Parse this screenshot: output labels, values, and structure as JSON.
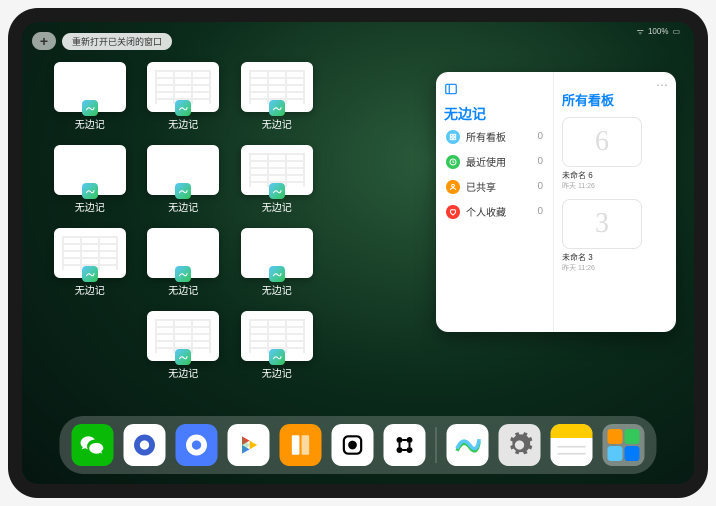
{
  "status": {
    "battery": "100%",
    "signal": "•••"
  },
  "top": {
    "reopen_label": "重新打开已关闭的窗口"
  },
  "window_label": "无边记",
  "windows": [
    {
      "content": false
    },
    {
      "content": true
    },
    {
      "content": true
    },
    {
      "content": false
    },
    {
      "content": false
    },
    {
      "content": true
    },
    {
      "content": true
    },
    {
      "content": false
    },
    {
      "content": false
    },
    {
      "content": true
    },
    {
      "content": true
    },
    {
      "content": false
    },
    {
      "content": false
    },
    {
      "content": true
    },
    {
      "content": true
    }
  ],
  "window_count_shown": 11,
  "main": {
    "app_title": "无边记",
    "content_title": "所有看板",
    "sidebar": [
      {
        "label": "所有看板",
        "count": 0,
        "color": "#5ac8fa",
        "icon": "grid"
      },
      {
        "label": "最近使用",
        "count": 0,
        "color": "#34c759",
        "icon": "clock"
      },
      {
        "label": "已共享",
        "count": 0,
        "color": "#ff9500",
        "icon": "person"
      },
      {
        "label": "个人收藏",
        "count": 0,
        "color": "#ff3b30",
        "icon": "heart"
      }
    ],
    "boards": [
      {
        "name": "未命名 6",
        "time": "昨天 11:26",
        "glyph": "6"
      },
      {
        "name": "未命名 3",
        "time": "昨天 11:26",
        "glyph": "3"
      }
    ]
  },
  "dock": [
    {
      "name": "wechat",
      "bg": "#09bb07",
      "glyph": "wechat"
    },
    {
      "name": "quark-hd",
      "bg": "#ffffff",
      "glyph": "quark-blue"
    },
    {
      "name": "quark",
      "bg": "#4a7cff",
      "glyph": "quark-white"
    },
    {
      "name": "play",
      "bg": "#ffffff",
      "glyph": "play"
    },
    {
      "name": "books",
      "bg": "#ff9500",
      "glyph": "books"
    },
    {
      "name": "dice",
      "bg": "#ffffff",
      "glyph": "dice"
    },
    {
      "name": "scan",
      "bg": "#ffffff",
      "glyph": "scan"
    },
    {
      "name": "sep"
    },
    {
      "name": "freeform",
      "bg": "#ffffff",
      "glyph": "freeform"
    },
    {
      "name": "settings",
      "bg": "#e5e5e5",
      "glyph": "gear"
    },
    {
      "name": "notes",
      "bg": "#ffffff",
      "glyph": "notes"
    },
    {
      "name": "folder",
      "bg": "folder"
    }
  ]
}
